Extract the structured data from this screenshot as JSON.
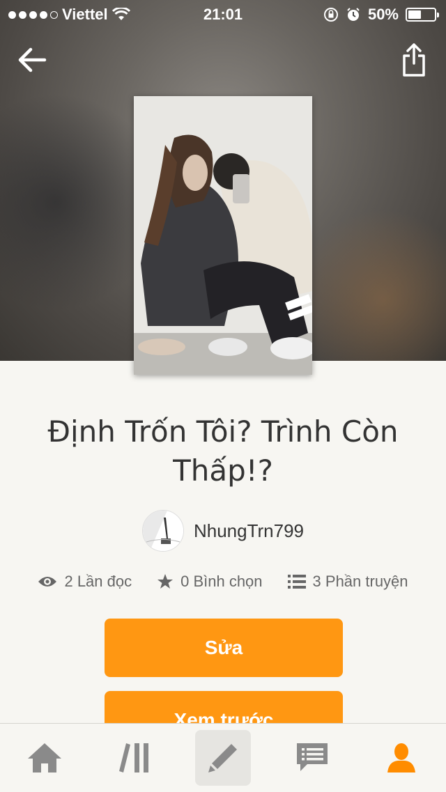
{
  "status_bar": {
    "carrier": "Viettel",
    "time": "21:01",
    "battery": "50%",
    "battery_level": 0.5
  },
  "header": {
    "back_icon": "arrow-left-icon",
    "share_icon": "share-icon"
  },
  "story": {
    "title": "Định Trốn Tôi? Trình Còn Thấp!?",
    "author": "NhungTrn799"
  },
  "stats": {
    "reads": "2 Lần đọc",
    "votes": "0 Bình chọn",
    "parts": "3 Phần truyện"
  },
  "actions": {
    "edit_label": "Sửa",
    "preview_label": "Xem trước"
  },
  "tabbar": {
    "items": [
      "home-icon",
      "library-icon",
      "write-icon",
      "messages-icon",
      "profile-icon"
    ],
    "active_color": "#ff8c00",
    "inactive_color": "#8a8a8a"
  },
  "colors": {
    "accent": "#ff9712"
  }
}
